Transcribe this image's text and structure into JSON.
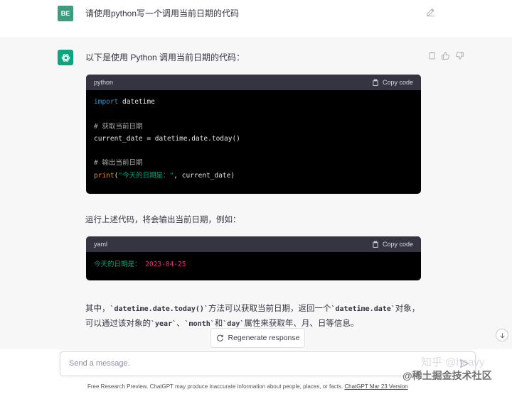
{
  "user": {
    "avatar": "BE",
    "message": "请使用python写一个调用当前日期的代码"
  },
  "assistant": {
    "intro": "以下是使用 Python 调用当前日期的代码：",
    "code1": {
      "lang": "python",
      "copy_label": "Copy code",
      "lines": {
        "l1_kw": "import",
        "l1_rest": " datetime",
        "l3": "# 获取当前日期",
        "l4": "current_date = datetime.date.today()",
        "l6": "# 输出当前日期",
        "l7_fn": "print",
        "l7_open": "(",
        "l7_str": "\"今天的日期是：\"",
        "l7_rest": ", current_date)"
      }
    },
    "middle_text": "运行上述代码，将会输出当前日期，例如：",
    "code2": {
      "lang": "yaml",
      "copy_label": "Copy code",
      "key": "今天的日期是：",
      "value": "2023-04-25"
    },
    "para1": {
      "a": "其中，",
      "b": "`datetime.date.today()`",
      "c": "方法可以获取当前日期，返回一个",
      "d": "`datetime.date`",
      "e": "对象，"
    },
    "para2": {
      "a": "可以通过该对象的",
      "b": "`year`",
      "c": "、",
      "d": "`month`",
      "e": "和",
      "f": "`day`",
      "g": "属性来获取年、月、日等信息。"
    }
  },
  "regenerate_label": "Regenerate response",
  "input": {
    "placeholder": "Send a message."
  },
  "footer": {
    "text": "Free Research Preview. ChatGPT may produce inaccurate information about people, places, or facts.",
    "link": "ChatGPT Mar 23 Version"
  },
  "watermark": {
    "zhihu": "知乎 @heavy",
    "juejin": "@稀土掘金技术社区"
  },
  "colors": {
    "accent": "#10a37f",
    "user_avatar": "#3e9c7e",
    "code_bg": "#000000",
    "code_header": "#343541"
  }
}
